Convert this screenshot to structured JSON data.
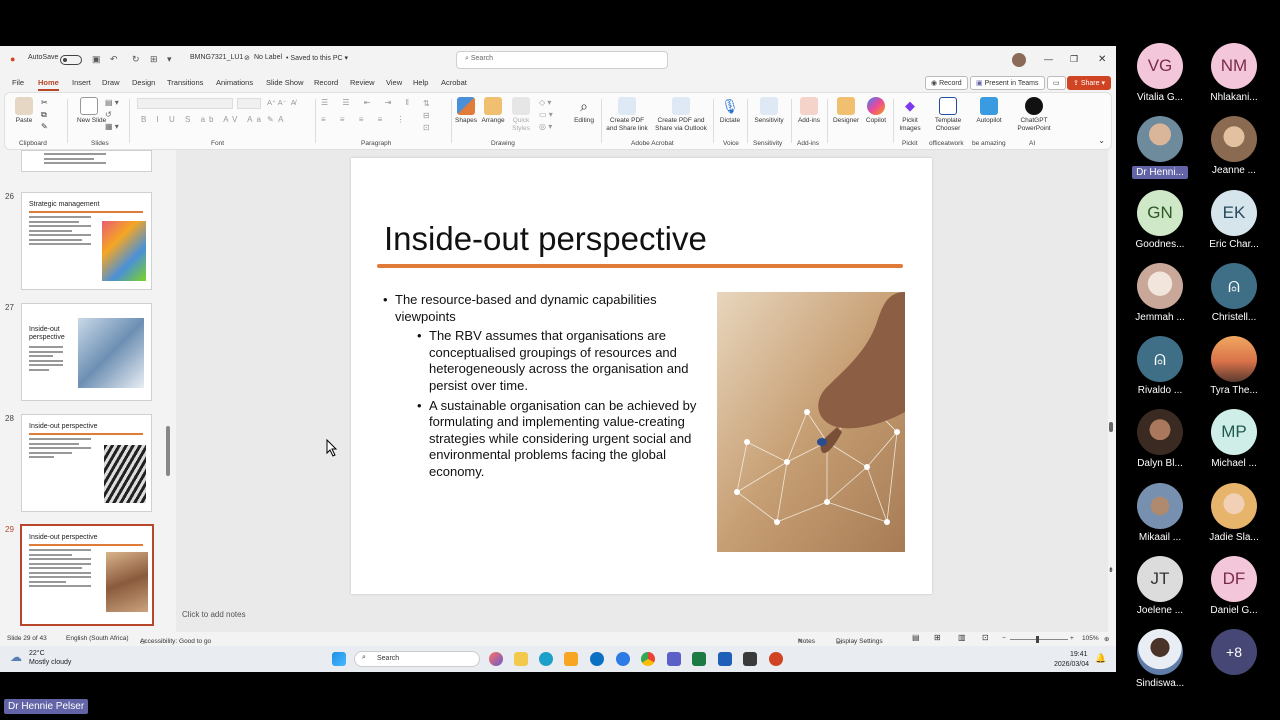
{
  "window": {
    "autosave_label": "AutoSave",
    "file_name": "BMNG7321_LU1",
    "label_status": "No Label",
    "save_status": "Saved to this PC",
    "search_placeholder": "Search"
  },
  "menu": {
    "items": [
      "File",
      "Home",
      "Insert",
      "Draw",
      "Design",
      "Transitions",
      "Animations",
      "Slide Show",
      "Record",
      "Review",
      "View",
      "Help",
      "Acrobat"
    ],
    "active": "Home",
    "record_label": "Record",
    "present_teams_label": "Present in Teams",
    "share_label": "Share"
  },
  "ribbon": {
    "paste": "Paste",
    "new_slide": "New Slide",
    "groups": [
      "Clipboard",
      "Slides",
      "Font",
      "Paragraph",
      "Drawing",
      "Adobe Acrobat",
      "Voice",
      "Sensitivity",
      "Add-ins",
      "Pickit",
      "officeatwork",
      "be amazing",
      "AI"
    ],
    "shapes": "Shapes",
    "arrange": "Arrange",
    "quick_styles": "Quick Styles",
    "editing": "Editing",
    "create_pdf_share": "Create PDF and Share link",
    "create_pdf_outlook": "Create PDF and Share via Outlook",
    "dictate": "Dictate",
    "sensitivity": "Sensitivity",
    "addins": "Add-ins",
    "designer": "Designer",
    "copilot": "Copilot",
    "pickit_images": "Pickit Images",
    "template_chooser": "Template Chooser",
    "autopilot": "Autopilot",
    "chatgpt_pp": "ChatGPT PowerPoint"
  },
  "thumbnails": [
    {
      "num": "26",
      "title": "Strategic management"
    },
    {
      "num": "27",
      "title": "Inside-out perspective"
    },
    {
      "num": "28",
      "title": "Inside-out perspective"
    },
    {
      "num": "29",
      "title": "Inside-out perspective"
    }
  ],
  "slide": {
    "title": "Inside-out perspective",
    "bullet1": "The resource-based and dynamic capabilities viewpoints",
    "sub1": "The RBV assumes that organisations are conceptualised groupings of resources and heterogeneously across the organisation and persist over time.",
    "sub2": "A sustainable organisation can be achieved by formulating and implementing value-creating strategies while considering urgent social and environmental problems facing the global economy."
  },
  "notes_placeholder": "Click to add notes",
  "status": {
    "slide_count": "Slide 29 of 43",
    "language": "English (South Africa)",
    "accessibility": "Accessibility: Good to go",
    "notes": "Notes",
    "display_settings": "Display Settings",
    "zoom": "105%"
  },
  "taskbar": {
    "weather_temp": "22°C",
    "weather_desc": "Mostly cloudy",
    "search": "Search",
    "time": "19:41",
    "date": "2026/03/04"
  },
  "participants": [
    {
      "initials": "VG",
      "name": "Vitalia G...",
      "color": "#f4c6d9"
    },
    {
      "initials": "NM",
      "name": "Nhlakani...",
      "color": "#f4c6d9"
    },
    {
      "initials": "",
      "name": "Dr Henni...",
      "color": "#9aa5ad"
    },
    {
      "initials": "",
      "name": "Jeanne ...",
      "color": "#c9a98a"
    },
    {
      "initials": "GN",
      "name": "Goodnes...",
      "color": "#cfe8c8"
    },
    {
      "initials": "EK",
      "name": "Eric Char...",
      "color": "#d6e4ec"
    },
    {
      "initials": "",
      "name": "Jemmah ...",
      "color": "#d9b5a8"
    },
    {
      "initials": "",
      "name": "Christell...",
      "color": "#3f6f86"
    },
    {
      "initials": "",
      "name": "Rivaldo ...",
      "color": "#3f6f86"
    },
    {
      "initials": "",
      "name": "Tyra The...",
      "color": "#d98c56"
    },
    {
      "initials": "",
      "name": "Dalyn Bl...",
      "color": "#7a5646"
    },
    {
      "initials": "MP",
      "name": "Michael ...",
      "color": "#cfeee8"
    },
    {
      "initials": "",
      "name": "Mikaail ...",
      "color": "#7890b0"
    },
    {
      "initials": "",
      "name": "Jadie Sla...",
      "color": "#e6c4a5"
    },
    {
      "initials": "JT",
      "name": "Joelene ...",
      "color": "#dcdcdc"
    },
    {
      "initials": "DF",
      "name": "Daniel G...",
      "color": "#f4c6d9"
    },
    {
      "initials": "",
      "name": "Sindiswa...",
      "color": "#5f7da8"
    },
    {
      "initials": "+8",
      "name": "",
      "color": "#464775"
    }
  ],
  "speaker": "Dr Hennie Pelser"
}
